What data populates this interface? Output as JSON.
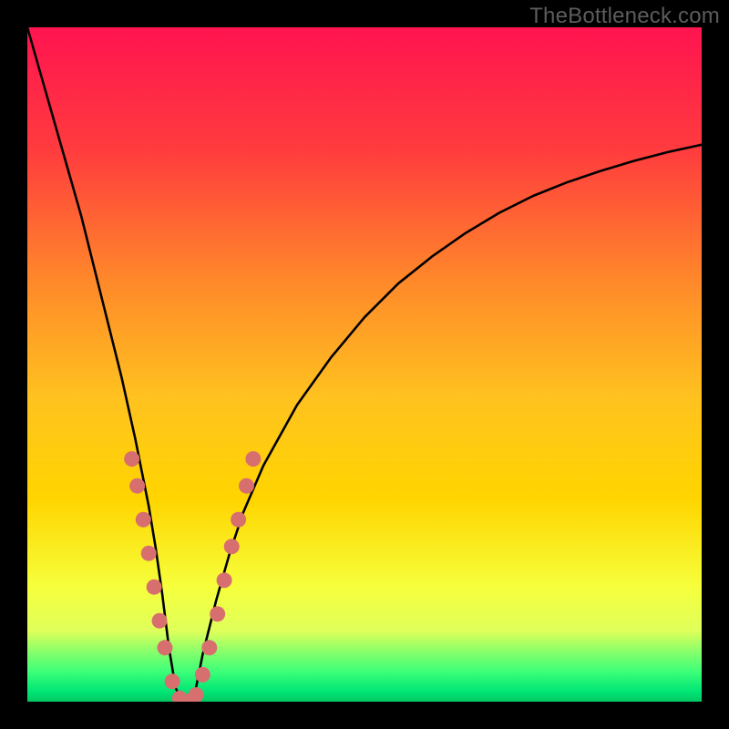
{
  "watermark": "TheBottleneck.com",
  "colors": {
    "bg_black": "#000000",
    "gradient_top": "#ff1450",
    "gradient_mid": "#ffd500",
    "gradient_bottom_band": "#dfff5a",
    "gradient_green_band1": "#8aff6a",
    "gradient_green_band2": "#3dff78",
    "gradient_green_band3": "#00e676",
    "curve": "#000000",
    "marker_fill": "#d86f6f",
    "marker_stroke": "#a64d4d",
    "watermark_text": "#5c5c5c"
  },
  "chart_data": {
    "type": "line",
    "title": "",
    "xlabel": "",
    "ylabel": "",
    "xlim": [
      0,
      100
    ],
    "ylim": [
      0,
      100
    ],
    "series": [
      {
        "name": "bottleneck-curve",
        "x": [
          0,
          2,
          4,
          6,
          8,
          10,
          12,
          14,
          16,
          17,
          18,
          19,
          20,
          21,
          22,
          23,
          24,
          25,
          26,
          28,
          30,
          32,
          35,
          40,
          45,
          50,
          55,
          60,
          65,
          70,
          75,
          80,
          85,
          90,
          95,
          100
        ],
        "y": [
          100,
          93,
          86,
          79,
          72,
          64,
          56,
          48,
          39,
          34,
          29,
          23,
          16,
          8,
          2,
          0,
          0,
          2,
          7,
          15,
          22,
          28,
          35,
          44,
          51,
          57,
          62,
          66,
          69.5,
          72.5,
          75,
          77,
          78.7,
          80.2,
          81.5,
          82.6
        ]
      }
    ],
    "markers": {
      "name": "highlighted-points",
      "points": [
        {
          "x": 15.5,
          "y": 36
        },
        {
          "x": 16.3,
          "y": 32
        },
        {
          "x": 17.2,
          "y": 27
        },
        {
          "x": 18.0,
          "y": 22
        },
        {
          "x": 18.8,
          "y": 17
        },
        {
          "x": 19.6,
          "y": 12
        },
        {
          "x": 20.4,
          "y": 8
        },
        {
          "x": 21.5,
          "y": 3
        },
        {
          "x": 22.6,
          "y": 0.5
        },
        {
          "x": 23.8,
          "y": 0
        },
        {
          "x": 25.0,
          "y": 1
        },
        {
          "x": 26.0,
          "y": 4
        },
        {
          "x": 27.0,
          "y": 8
        },
        {
          "x": 28.2,
          "y": 13
        },
        {
          "x": 29.2,
          "y": 18
        },
        {
          "x": 30.3,
          "y": 23
        },
        {
          "x": 31.3,
          "y": 27
        },
        {
          "x": 32.5,
          "y": 32
        },
        {
          "x": 33.5,
          "y": 36
        }
      ]
    }
  }
}
